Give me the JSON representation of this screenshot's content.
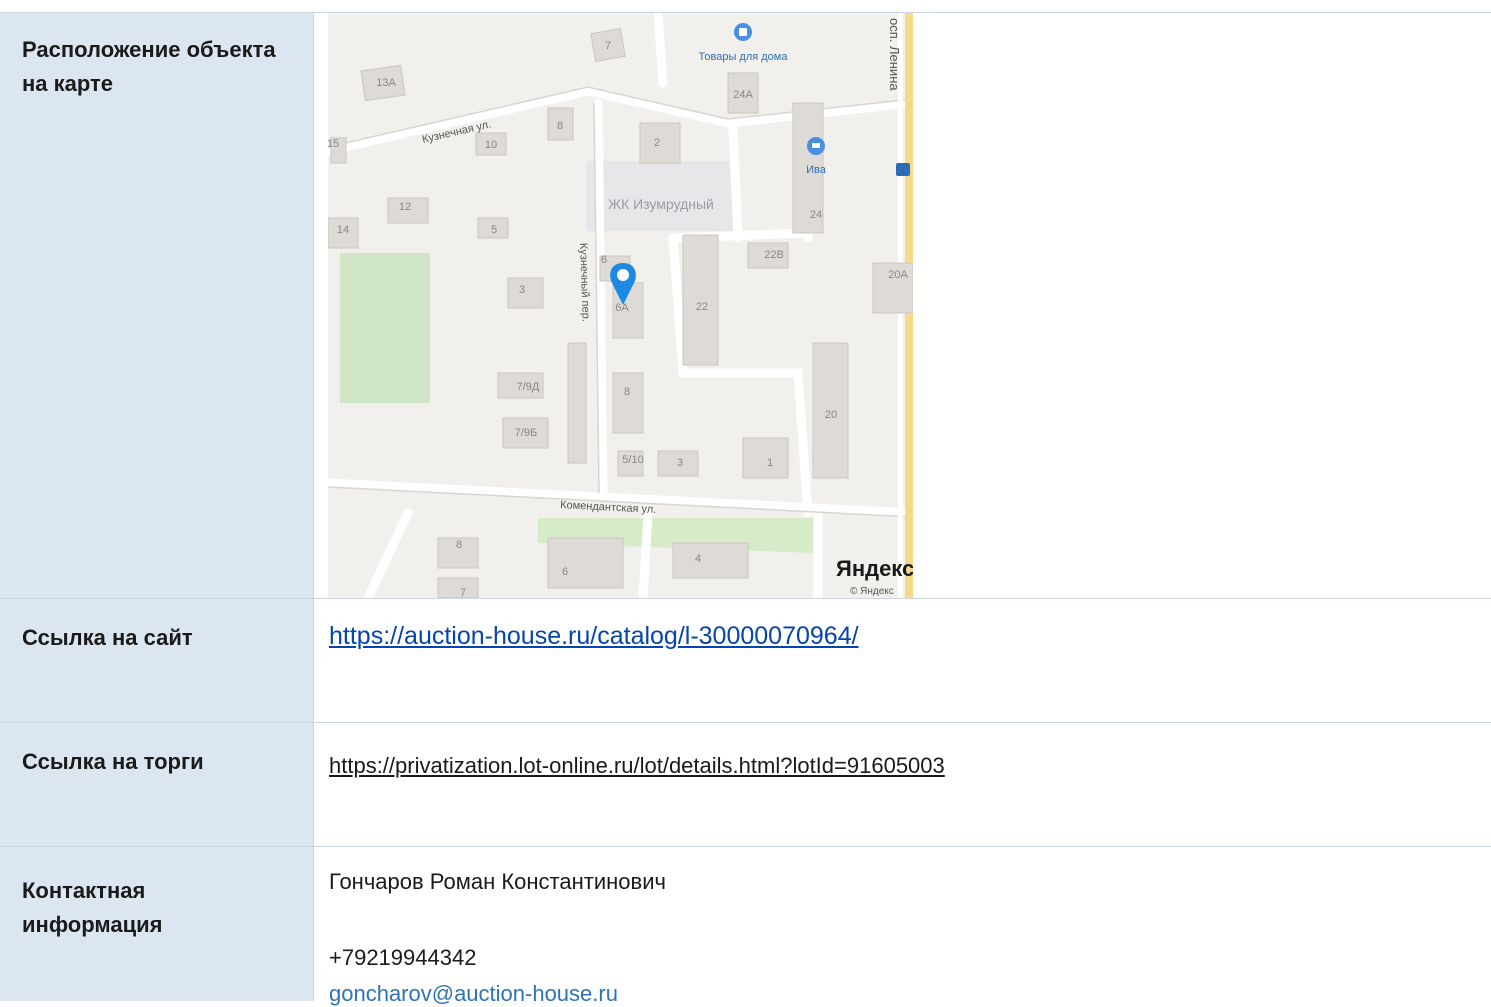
{
  "rows": {
    "map": {
      "label": "Расположение объекта на карте"
    },
    "site": {
      "label": "Ссылка на сайт",
      "url": "https://auction-house.ru/catalog/l-30000070964/"
    },
    "auction": {
      "label": "Ссылка на торги",
      "url": "https://privatization.lot-online.ru/lot/details.html?lotId=91605003"
    },
    "contact": {
      "label": "Контактная информация",
      "name": "Гончаров Роман Константинович",
      "phone": "+79219944342",
      "email": "goncharov@auction-house.ru"
    }
  },
  "map": {
    "streets": {
      "kuznechnaya": "Кузнечная ул.",
      "kuznechny_per": "Кузнечный пер.",
      "komendantskaya": "Комендантская ул.",
      "prosp_lenina": "осп. Ленина"
    },
    "places": {
      "goods_for_home": "Товары для дома",
      "iva": "Ива",
      "complex": "ЖК Изумрудный"
    },
    "buildings": [
      "7",
      "13А",
      "10",
      "8",
      "15",
      "24А",
      "2",
      "12",
      "14",
      "5",
      "24",
      "22В",
      "20А",
      "3",
      "6",
      "6А",
      "22",
      "7/9Д",
      "8",
      "7/9Б",
      "20",
      "5/10",
      "3",
      "1",
      "8",
      "6",
      "4",
      "7"
    ],
    "logo": "Яндекс",
    "copyright": "© Яндекс",
    "marker_color": "#1e88e5",
    "icons": [
      "shopping-bag-icon",
      "cart-icon",
      "bus-stop-icon",
      "location-pin-icon"
    ]
  }
}
